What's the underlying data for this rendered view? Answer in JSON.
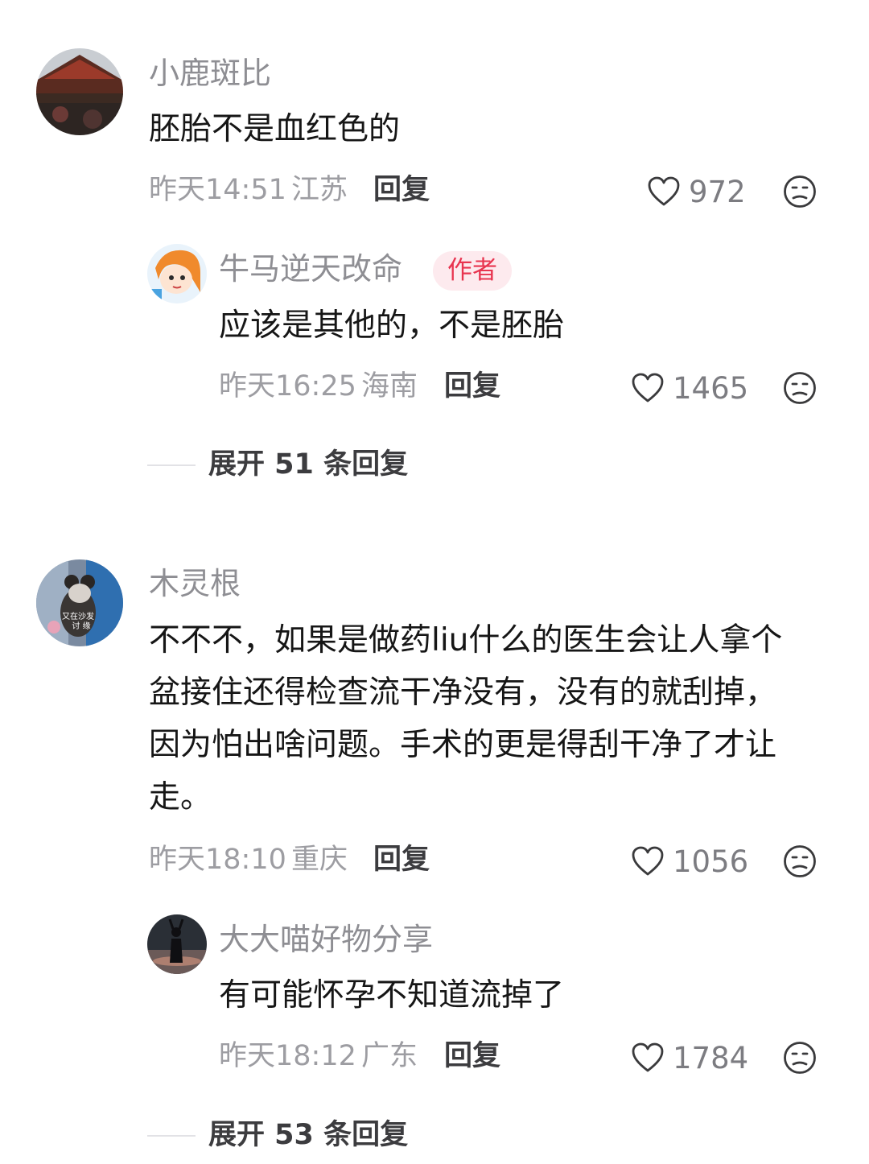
{
  "comments": [
    {
      "name": "小鹿斑比",
      "text_lines": [
        "胚胎不是血红色的"
      ],
      "time": "昨天14:51",
      "location": "江苏",
      "reply_label": "回复",
      "likes": "972",
      "replies": [
        {
          "name": "牛马逆天改命",
          "badge": "作者",
          "text_lines": [
            "应该是其他的，不是胚胎"
          ],
          "time": "昨天16:25",
          "location": "海南",
          "reply_label": "回复",
          "likes": "1465"
        }
      ],
      "expand_label": "展开 51 条回复"
    },
    {
      "name": "木灵根",
      "avatar_text": "又在沙发\n讨 缘",
      "text_lines": [
        "不不不，如果是做药liu什么的医生会让人拿个",
        "盆接住还得检查流干净没有，没有的就刮掉，",
        "因为怕出啥问题。手术的更是得刮干净了才让",
        "走。"
      ],
      "time": "昨天18:10",
      "location": "重庆",
      "reply_label": "回复",
      "likes": "1056",
      "replies": [
        {
          "name": "大大喵好物分享",
          "text_lines": [
            "有可能怀孕不知道流掉了"
          ],
          "time": "昨天18:12",
          "location": "广东",
          "reply_label": "回复",
          "likes": "1784"
        }
      ],
      "expand_label": "展开 53 条回复"
    }
  ],
  "icons": {
    "like": "heart-outline-icon",
    "dislike": "frown-face-icon"
  },
  "colors": {
    "badge_bg": "#fdeaee",
    "badge_text": "#e8344f",
    "name": "#8e8e93",
    "meta": "#9d9da2"
  }
}
